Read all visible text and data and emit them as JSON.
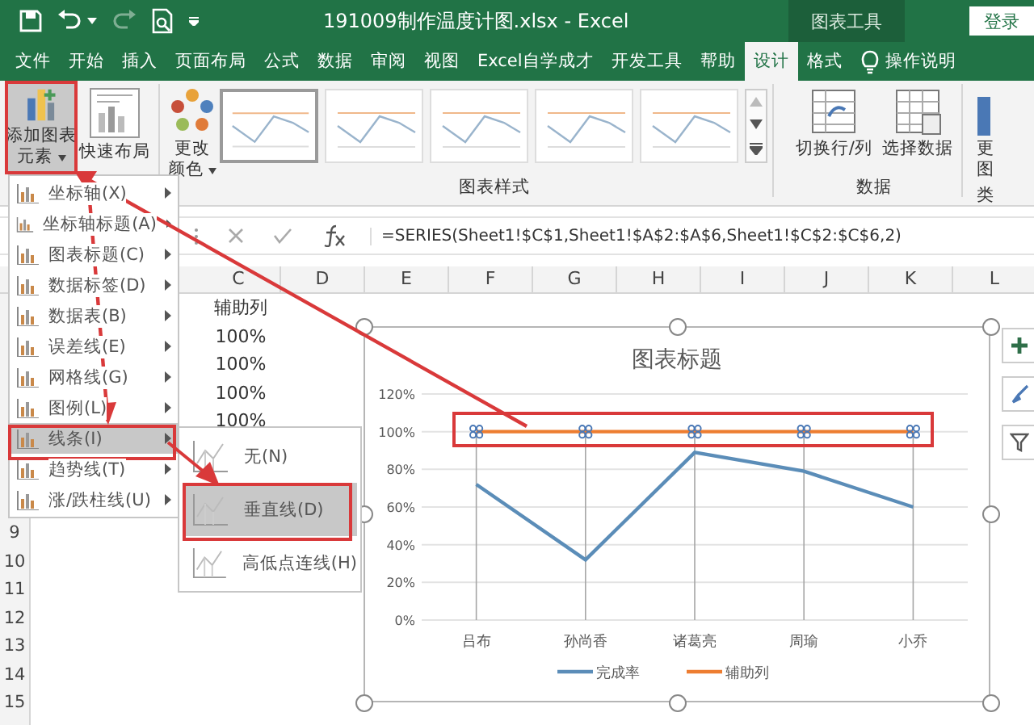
{
  "title_bar": {
    "title": "191009制作温度计图.xlsx  -  Excel",
    "context_tab": "图表工具",
    "sign_in": "登录"
  },
  "ribbon_tabs": [
    {
      "label": "文件",
      "selected": false
    },
    {
      "label": "开始",
      "selected": false
    },
    {
      "label": "插入",
      "selected": false
    },
    {
      "label": "页面布局",
      "selected": false
    },
    {
      "label": "公式",
      "selected": false
    },
    {
      "label": "数据",
      "selected": false
    },
    {
      "label": "审阅",
      "selected": false
    },
    {
      "label": "视图",
      "selected": false
    },
    {
      "label": "Excel自学成才",
      "selected": false
    },
    {
      "label": "开发工具",
      "selected": false
    },
    {
      "label": "帮助",
      "selected": false
    },
    {
      "label": "设计",
      "selected": true
    },
    {
      "label": "格式",
      "selected": false
    }
  ],
  "tell_me": "操作说明",
  "ribbon": {
    "add_element": [
      "添加图表",
      "元素"
    ],
    "quick_layout": "快速布局",
    "change_colors": [
      "更改",
      "颜色"
    ],
    "styles": [
      {
        "selected": true
      },
      {
        "selected": false
      },
      {
        "selected": false
      },
      {
        "selected": false
      },
      {
        "selected": false
      }
    ],
    "styles_label": "图表样式",
    "switch_row_col": "切换行/列",
    "select_data": "选择数据",
    "data_label": "数据",
    "change_type": [
      "更",
      "图"
    ],
    "type_label": "类"
  },
  "formula_bar": {
    "formula": "=SERIES(Sheet1!$C$1,Sheet1!$A$2:$A$6,Sheet1!$C$2:$C$6,2)"
  },
  "columns": [
    "C",
    "D",
    "E",
    "F",
    "G",
    "H",
    "I",
    "J",
    "K",
    "L"
  ],
  "row_numbers": [
    "9",
    "10",
    "11",
    "12",
    "13",
    "14",
    "15"
  ],
  "column_c_cells": [
    "辅助列",
    "100%",
    "100%",
    "100%",
    "100%"
  ],
  "menu": {
    "items": [
      {
        "label": "坐标轴(X)",
        "selected": false
      },
      {
        "label": "坐标轴标题(A)",
        "selected": false
      },
      {
        "label": "图表标题(C)",
        "selected": false
      },
      {
        "label": "数据标签(D)",
        "selected": false
      },
      {
        "label": "数据表(B)",
        "selected": false
      },
      {
        "label": "误差线(E)",
        "selected": false
      },
      {
        "label": "网格线(G)",
        "selected": false
      },
      {
        "label": "图例(L)",
        "selected": false
      },
      {
        "label": "线条(I)",
        "selected": true
      },
      {
        "label": "趋势线(T)",
        "selected": false
      },
      {
        "label": "涨/跌柱线(U)",
        "selected": false
      }
    ]
  },
  "submenu": {
    "items": [
      {
        "label": "无(N)",
        "selected": false
      },
      {
        "label": "垂直线(D)",
        "selected": true
      },
      {
        "label": "高低点连线(H)",
        "selected": false
      }
    ]
  },
  "chart": {
    "chart_data": {
      "type": "line",
      "title": "图表标题",
      "categories": [
        "吕布",
        "孙尚香",
        "诸葛亮",
        "周瑜",
        "小乔"
      ],
      "series": [
        {
          "name": "完成率",
          "color": "#5b8db8",
          "values": [
            0.72,
            0.32,
            0.89,
            0.79,
            0.6
          ]
        },
        {
          "name": "辅助列",
          "color": "#ed7d31",
          "values": [
            1,
            1,
            1,
            1,
            1
          ]
        }
      ],
      "ylim": [
        0,
        1.2
      ],
      "grid": true,
      "legend": true,
      "yticks": [
        {
          "value": 0,
          "label": "0%"
        },
        {
          "value": 0.2,
          "label": "20%"
        },
        {
          "value": 0.4,
          "label": "40%"
        },
        {
          "value": 0.6,
          "label": "60%"
        },
        {
          "value": 0.8,
          "label": "80%"
        },
        {
          "value": 1,
          "label": "100%"
        },
        {
          "value": 1.2,
          "label": "120%"
        }
      ]
    }
  }
}
